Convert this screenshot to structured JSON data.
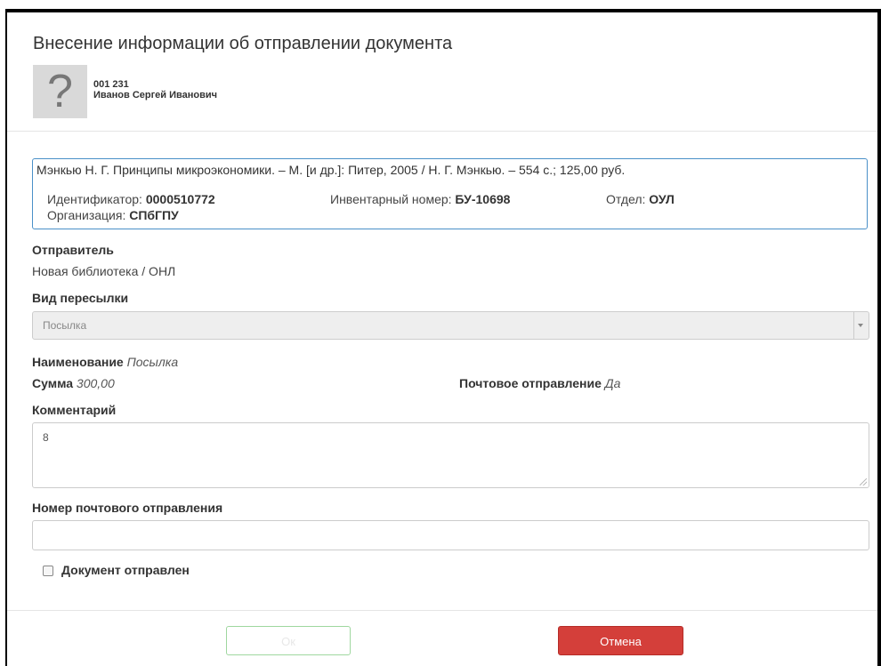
{
  "dialog": {
    "title": "Внесение информации об отправлении документа"
  },
  "reader": {
    "avatar_icon": "question-mark-icon",
    "avatar_glyph": "?",
    "id": "001 231",
    "name": "Иванов Сергей Иванович"
  },
  "document": {
    "description": "Мэнкью Н. Г. Принципы микроэкономики. – М. [и др.]: Питер, 2005 / Н. Г. Мэнкью. – 554 с.; 125,00 руб.",
    "identifier_label": "Идентификатор:",
    "identifier_value": "0000510772",
    "inventory_label": "Инвентарный номер:",
    "inventory_value": "БУ-10698",
    "department_label": "Отдел:",
    "department_value": "ОУЛ",
    "organization_label": "Организация:",
    "organization_value": "СПбГПУ"
  },
  "sender": {
    "label": "Отправитель",
    "value": "Новая библиотека / ОНЛ"
  },
  "shipping": {
    "label": "Вид пересылки",
    "selected": "Посылка",
    "arrow_icon": "chevron-down-icon"
  },
  "details": {
    "name_label": "Наименование",
    "name_value": "Посылка",
    "sum_label": "Сумма",
    "sum_value": "300,00",
    "postal_label": "Почтовое отправление",
    "postal_value": "Да"
  },
  "comment": {
    "label": "Комментарий",
    "value": "8"
  },
  "tracking": {
    "label": "Номер почтового отправления",
    "value": ""
  },
  "sent_checkbox": {
    "label": "Документ отправлен",
    "checked": false
  },
  "buttons": {
    "ok": "Ок",
    "cancel": "Отмена",
    "cancel_color": "#d43f3a",
    "ok_border_color": "#9fd79f"
  },
  "colors": {
    "doc_box_border": "#4a90c8"
  }
}
